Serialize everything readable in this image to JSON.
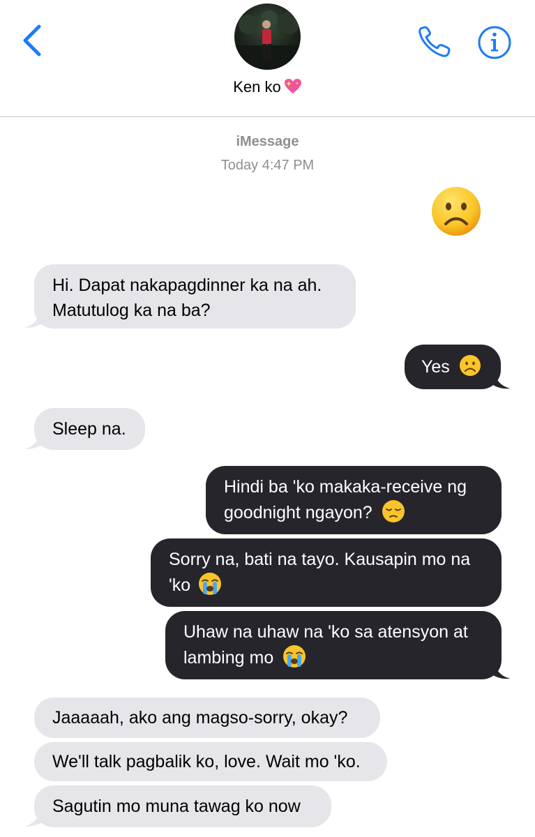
{
  "header": {
    "contact_name": "Ken ko"
  },
  "conversation": {
    "service": "iMessage",
    "timestamp": "Today 4:47 PM"
  },
  "messages": [
    {
      "from": "me",
      "emoji": "frowning-face"
    },
    {
      "from": "them",
      "text": "Hi. Dapat nakapagdinner ka na ah.",
      "text2": "Matutulog ka na ba?"
    },
    {
      "from": "me",
      "text": "Yes",
      "emoji": "frowning-face"
    },
    {
      "from": "them",
      "text": "Sleep na."
    },
    {
      "from": "me",
      "text": "Hindi ba 'ko makaka-receive ng",
      "text2": "goodnight ngayon?",
      "emoji": "pensive-face"
    },
    {
      "from": "me",
      "text": "Sorry na, bati na tayo. Kausapin mo na",
      "text2": "'ko",
      "emoji": "crying-face"
    },
    {
      "from": "me",
      "text": "Uhaw na uhaw na 'ko sa atensyon at",
      "text2": "lambing mo",
      "emoji": "crying-face"
    },
    {
      "from": "them",
      "text": "Jaaaaah, ako ang magso-sorry, okay?"
    },
    {
      "from": "them",
      "text": "We'll talk pagbalik ko, love. Wait mo 'ko."
    },
    {
      "from": "them",
      "text": "Sagutin mo muna tawag ko now"
    }
  ],
  "colors": {
    "accent": "#1a7cf5",
    "incoming_bubble": "#e5e5ea",
    "outgoing_bubble": "#26252b"
  }
}
